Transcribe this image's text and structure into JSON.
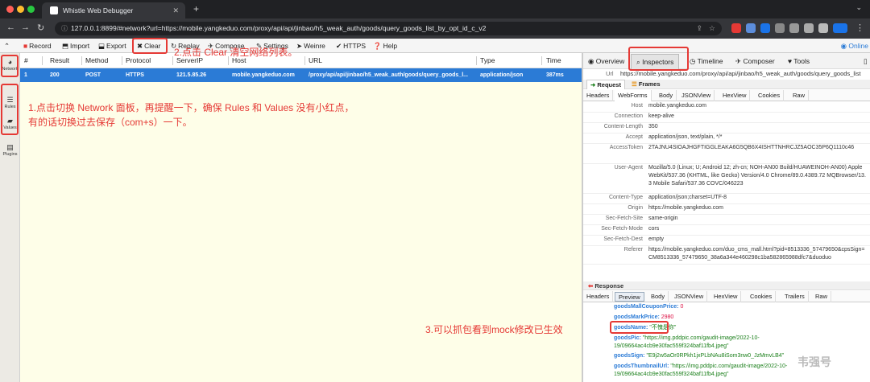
{
  "browser": {
    "tab_title": "Whistle Web Debugger",
    "url": "127.0.0.1:8899/#network?url=https://mobile.yangkeduo.com/proxy/api/api/jinbao/h5_weak_auth/goods/query_goods_list_by_opt_id_c_v2"
  },
  "toolbar": {
    "record": "Record",
    "import": "Import",
    "export": "Export",
    "clear": "Clear",
    "replay": "Replay",
    "compose": "Compose",
    "settings": "Settings",
    "weinre": "Weinre",
    "https": "HTTPS",
    "help": "Help",
    "online": "Online"
  },
  "sidebar": {
    "items": [
      {
        "label": "Network",
        "icon": "globe-icon"
      },
      {
        "label": "Rules",
        "icon": "list-icon"
      },
      {
        "label": "Values",
        "icon": "folder-icon"
      },
      {
        "label": "Plugins",
        "icon": "plugin-icon"
      }
    ]
  },
  "network": {
    "columns": [
      "#",
      "Result",
      "Method",
      "Protocol",
      "ServerIP",
      "Host",
      "URL",
      "Type",
      "Time"
    ],
    "rows": [
      {
        "num": "1",
        "result": "200",
        "method": "POST",
        "protocol": "HTTPS",
        "server_ip": "121.5.85.26",
        "host": "mobile.yangkeduo.com",
        "url": "/proxy/api/api/jinbao/h5_weak_auth/goods/query_goods_l...",
        "type": "application/json",
        "time": "387ms"
      }
    ]
  },
  "inspector": {
    "tabs": [
      "Overview",
      "Inspectors",
      "Timeline",
      "Composer",
      "Tools"
    ],
    "url_label": "Url",
    "url_value": "https://mobile.yangkeduo.com/proxy/api/api/jinbao/h5_weak_auth/goods/query_goods_list",
    "request_tabs": [
      "Request",
      "Frames"
    ],
    "req_subtabs": [
      "Headers",
      "WebForms",
      "Body",
      "JSONView",
      "HexView",
      "Cookies",
      "Raw"
    ],
    "headers": [
      {
        "k": "Host",
        "v": "mobile.yangkeduo.com"
      },
      {
        "k": "Connection",
        "v": "keep-alive"
      },
      {
        "k": "Content-Length",
        "v": "350"
      },
      {
        "k": "Accept",
        "v": "application/json, text/plain, */*"
      },
      {
        "k": "AccessToken",
        "v": "2TAJNU4SIOAJHGFTIGGLEAKA6G5QB6X4ISHTTNHRCJZ5AOC35P6Q1110c46"
      },
      {
        "k": "User-Agent",
        "v": "Mozilla/5.0 (Linux; U; Android 12; zh-cn; NOH-AN00 Build/HUAWEINOH-AN00) AppleWebKit/537.36 (KHTML, like Gecko) Version/4.0 Chrome/89.0.4389.72 MQBrowser/13.3 Mobile Safari/537.36 COVC/046223"
      },
      {
        "k": "Content-Type",
        "v": "application/json;charset=UTF-8"
      },
      {
        "k": "Origin",
        "v": "https://mobile.yangkeduo.com"
      },
      {
        "k": "Sec-Fetch-Site",
        "v": "same-origin"
      },
      {
        "k": "Sec-Fetch-Mode",
        "v": "cors"
      },
      {
        "k": "Sec-Fetch-Dest",
        "v": "empty"
      },
      {
        "k": "Referer",
        "v": "https://mobile.yangkeduo.com/duo_cms_mall.html?pid=8513336_57479650&cpsSign=CM8513336_57479650_38a6a344e460298c1ba582865988dfc7&duoduo"
      }
    ],
    "response_title": "Response",
    "resp_subtabs": [
      "Headers",
      "Preview",
      "Body",
      "JSONView",
      "HexView",
      "Cookies",
      "Trailers",
      "Raw"
    ],
    "json": [
      {
        "k": "goodsMallCouponPrice:",
        "v": "0",
        "t": "num"
      },
      {
        "k": "goodsMarkPrice:",
        "v": "2980",
        "t": "num"
      },
      {
        "k": "goodsName:",
        "v": "\"不愧是你\"",
        "t": "str"
      },
      {
        "k": "goodsPic:",
        "v": "\"https://img.pddpic.com/gaudit-image/2022-10-19/09664ac4cb9e30fac559f324baf11fb4.jpeg\"",
        "t": "str"
      },
      {
        "k": "goodsSign:",
        "v": "\"E9j2w5aOr0RPkh1jxPLbNAu8iSom3nw0_JzMmvLB4\"",
        "t": "str"
      },
      {
        "k": "goodsThumbnailUrl:",
        "v": "\"https://img.pddpic.com/gaudit-image/2022-10-19/09664ac4cb9e30fac559f324baf11fb4.jpeg\"",
        "t": "str"
      }
    ]
  },
  "annotations": {
    "step1": "1.点击切换 Network 面板，再提醒一下，确保 Rules 和 Values 没有小红点，",
    "step1b": "有的话切换过去保存（com+s）一下。",
    "step2": "2.点击 Clear 清空网络列表。",
    "step3": "3.可以抓包看到mock修改已生效"
  },
  "watermark": "韦强号",
  "colors": {
    "accent": "#2b7bd6",
    "annotation": "#e53935",
    "list_bg": "#fefee8"
  }
}
